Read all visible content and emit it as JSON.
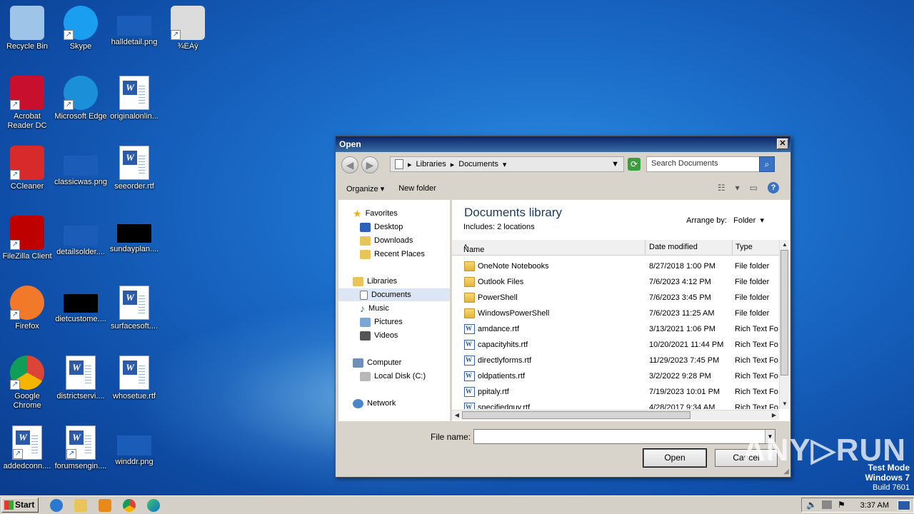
{
  "desktop": {
    "icons": [
      {
        "label": "Recycle Bin",
        "icon": "recycle-bin-icon"
      },
      {
        "label": "Skype",
        "icon": "skype-icon"
      },
      {
        "label": "halldetail.png",
        "icon": "image-file-icon"
      },
      {
        "label": "¾ËÁý",
        "icon": "shortcut-icon"
      },
      {
        "label": "Acrobat Reader DC",
        "icon": "acrobat-icon"
      },
      {
        "label": "Microsoft Edge",
        "icon": "edge-icon"
      },
      {
        "label": "originalonlin...",
        "icon": "word-doc-icon"
      },
      {
        "label": "CCleaner",
        "icon": "ccleaner-icon"
      },
      {
        "label": "classicwas.png",
        "icon": "image-file-icon"
      },
      {
        "label": "seeorder.rtf",
        "icon": "word-doc-icon"
      },
      {
        "label": "FileZilla Client",
        "icon": "filezilla-icon"
      },
      {
        "label": "detailsolder....",
        "icon": "image-file-icon"
      },
      {
        "label": "sundayplan....",
        "icon": "image-file-icon"
      },
      {
        "label": "Firefox",
        "icon": "firefox-icon"
      },
      {
        "label": "dietcustome....",
        "icon": "image-file-icon"
      },
      {
        "label": "surfacesoft....",
        "icon": "word-doc-icon"
      },
      {
        "label": "Google Chrome",
        "icon": "chrome-icon"
      },
      {
        "label": "districtservi....",
        "icon": "word-doc-icon"
      },
      {
        "label": "whosetue.rtf",
        "icon": "word-doc-icon"
      },
      {
        "label": "addedconn....",
        "icon": "word-doc-icon"
      },
      {
        "label": "forumsengin....",
        "icon": "word-doc-icon"
      },
      {
        "label": "winddr.png",
        "icon": "image-file-icon"
      }
    ]
  },
  "dialog": {
    "title": "Open",
    "close_glyph": "✕",
    "breadcrumb": [
      "Libraries",
      "Documents"
    ],
    "search_placeholder": "Search Documents",
    "organize": "Organize",
    "new_folder": "New folder",
    "nav": {
      "favorites": "Favorites",
      "desktop": "Desktop",
      "downloads": "Downloads",
      "recent": "Recent Places",
      "libraries": "Libraries",
      "documents": "Documents",
      "music": "Music",
      "pictures": "Pictures",
      "videos": "Videos",
      "computer": "Computer",
      "localdisk": "Local Disk (C:)",
      "network": "Network"
    },
    "library_title": "Documents library",
    "library_sub": "Includes:  2 locations",
    "arrange_label": "Arrange by:",
    "arrange_value": "Folder",
    "columns": {
      "name": "Name",
      "date": "Date modified",
      "type": "Type"
    },
    "files": [
      {
        "name": "OneNote Notebooks",
        "date": "8/27/2018 1:00 PM",
        "type": "File folder",
        "kind": "folder"
      },
      {
        "name": "Outlook Files",
        "date": "7/6/2023 4:12 PM",
        "type": "File folder",
        "kind": "folder"
      },
      {
        "name": "PowerShell",
        "date": "7/6/2023 3:45 PM",
        "type": "File folder",
        "kind": "folder"
      },
      {
        "name": "WindowsPowerShell",
        "date": "7/6/2023 11:25 AM",
        "type": "File folder",
        "kind": "folder"
      },
      {
        "name": "amdance.rtf",
        "date": "3/13/2021 1:06 PM",
        "type": "Rich Text Fo",
        "kind": "rtf"
      },
      {
        "name": "capacityhits.rtf",
        "date": "10/20/2021 11:44 PM",
        "type": "Rich Text Fo",
        "kind": "rtf"
      },
      {
        "name": "directlyforms.rtf",
        "date": "11/29/2023 7:45 PM",
        "type": "Rich Text Fo",
        "kind": "rtf"
      },
      {
        "name": "oldpatients.rtf",
        "date": "3/2/2022 9:28 PM",
        "type": "Rich Text Fo",
        "kind": "rtf"
      },
      {
        "name": "ppitaly.rtf",
        "date": "7/19/2023 10:01 PM",
        "type": "Rich Text Fo",
        "kind": "rtf"
      },
      {
        "name": "specifiedguy.rtf",
        "date": "4/28/2017 9:34 AM",
        "type": "Rich Text Fo",
        "kind": "rtf"
      }
    ],
    "filename_label": "File name:",
    "filename_value": "",
    "open_label": "Open",
    "cancel_label": "Cancel"
  },
  "watermark": {
    "text": "ANY▷RUN",
    "testmode": "Test Mode",
    "os": "Windows 7",
    "build": "Build 7601"
  },
  "taskbar": {
    "start": "Start",
    "time": "3:37 AM"
  }
}
